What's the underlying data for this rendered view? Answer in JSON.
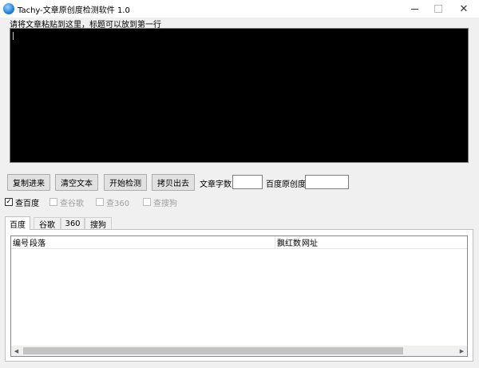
{
  "window": {
    "title": "Tachy-文章原创度检测软件 1.0",
    "close_glyph": "✕"
  },
  "editor": {
    "prompt": "请将文章粘贴到这里，标题可以放到第一行",
    "background": "#000000"
  },
  "toolbar": {
    "copy_in": "复制进来",
    "clear_text": "清空文本",
    "start_check": "开始检测",
    "copy_out": "拷贝出去",
    "word_count_label": "文章字数:",
    "word_count_value": "",
    "baidu_originality_label": "百度原创度:",
    "baidu_originality_value": ""
  },
  "engines": [
    {
      "label": "查百度",
      "checked": true,
      "enabled": true
    },
    {
      "label": "查谷歌",
      "checked": false,
      "enabled": false
    },
    {
      "label": "查360",
      "checked": false,
      "enabled": false
    },
    {
      "label": "查搜狗",
      "checked": false,
      "enabled": false
    }
  ],
  "tabs": [
    {
      "label": "百度",
      "active": true
    },
    {
      "label": "谷歌",
      "active": false
    },
    {
      "label": "360",
      "active": false
    },
    {
      "label": "搜狗",
      "active": false
    }
  ],
  "results_table": {
    "columns": [
      "编号",
      "段落",
      "飘红数",
      "网址"
    ],
    "rows": []
  },
  "colors": {
    "accent": "#2a88d8",
    "window_bg": "#f0f0f0"
  }
}
